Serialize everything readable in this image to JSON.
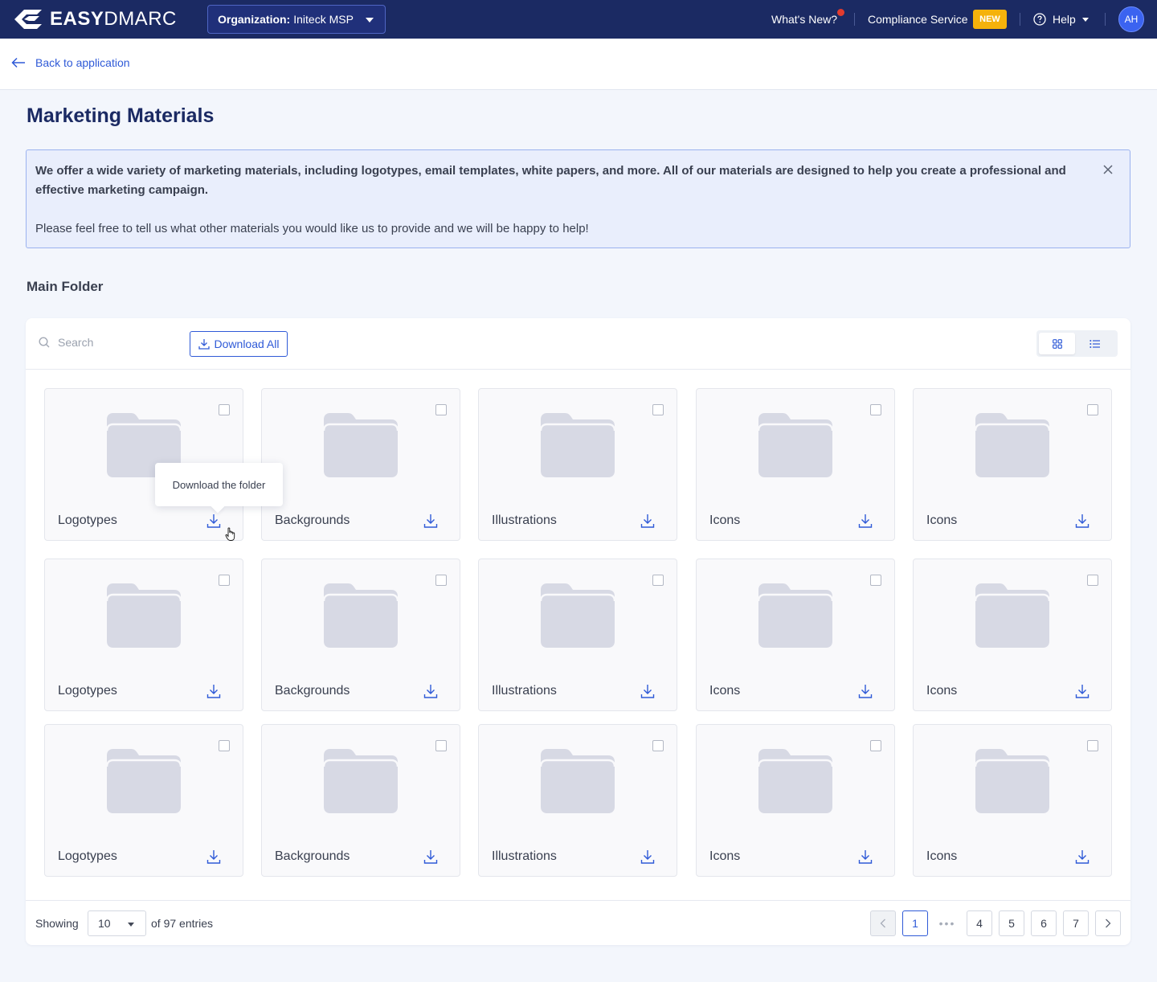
{
  "brand": {
    "name_bold": "EASY",
    "name_light": "DMARC"
  },
  "header": {
    "org_label": "Organization:",
    "org_value": "Initeck MSP",
    "whats_new": "What's New?",
    "compliance": "Compliance Service",
    "new_badge": "NEW",
    "help": "Help",
    "avatar": "AH"
  },
  "subheader": {
    "back": "Back to application"
  },
  "page": {
    "title": "Marketing Materials",
    "banner_strong": "We offer a wide variety of marketing materials, including logotypes, email templates, white papers, and more. All of our materials are designed to help you create a professional and effective marketing campaign.",
    "banner_text": "Please feel free to tell us what other materials you would like us to provide and we will be happy to help!",
    "section_title": "Main Folder"
  },
  "toolbar": {
    "search_placeholder": "Search",
    "download_all": "Download All"
  },
  "tiles": [
    "Logotypes",
    "Backgrounds",
    "Illustrations",
    "Icons",
    "Icons",
    "Logotypes",
    "Backgrounds",
    "Illustrations",
    "Icons",
    "Icons",
    "Logotypes",
    "Backgrounds",
    "Illustrations",
    "Icons",
    "Icons"
  ],
  "tooltip": "Download the folder",
  "footer": {
    "showing": "Showing",
    "per_page": "10",
    "entries": "of 97 entries",
    "pages": {
      "current": "1",
      "dots": "•••",
      "p4": "4",
      "p5": "5",
      "p6": "6",
      "p7": "7"
    }
  },
  "colors": {
    "navbar": "#1b2a63",
    "accent": "#2f5ad7",
    "new_badge": "#f5b20b",
    "folder": "#d7d9e4"
  }
}
